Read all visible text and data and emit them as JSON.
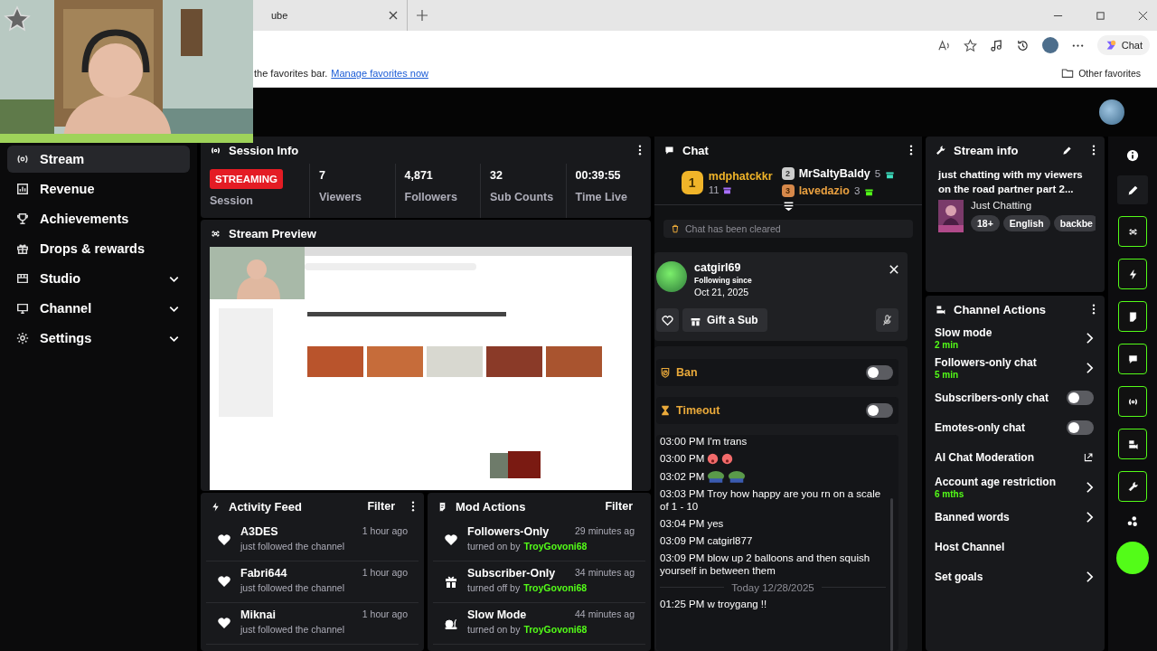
{
  "browser": {
    "tab_title": "ube",
    "favorites_hint": "the favorites bar.",
    "favorites_link": "Manage favorites now",
    "other_favorites": "Other favorites",
    "chat_button": "Chat"
  },
  "sidebar": {
    "items": [
      {
        "label": "Stream",
        "selected": true,
        "expandable": false
      },
      {
        "label": "Revenue",
        "selected": false,
        "expandable": false
      },
      {
        "label": "Achievements",
        "selected": false,
        "expandable": false
      },
      {
        "label": "Drops & rewards",
        "selected": false,
        "expandable": false
      },
      {
        "label": "Studio",
        "selected": false,
        "expandable": true
      },
      {
        "label": "Channel",
        "selected": false,
        "expandable": true
      },
      {
        "label": "Settings",
        "selected": false,
        "expandable": true
      }
    ]
  },
  "session": {
    "title": "Session Info",
    "status": "STREAMING",
    "caption": "Session",
    "stats": [
      {
        "value": "7",
        "label": "Viewers"
      },
      {
        "value": "4,871",
        "label": "Followers"
      },
      {
        "value": "32",
        "label": "Sub Counts"
      },
      {
        "value": "00:39:55",
        "label": "Time Live"
      }
    ]
  },
  "preview": {
    "title": "Stream Preview"
  },
  "activity_feed": {
    "title": "Activity Feed",
    "filter": "Filter",
    "items": [
      {
        "name": "A3DES",
        "time": "1 hour ago",
        "text": "just followed the channel"
      },
      {
        "name": "Fabri644",
        "time": "1 hour ago",
        "text": "just followed the channel"
      },
      {
        "name": "Miknai",
        "time": "1 hour ago",
        "text": "just followed the channel"
      }
    ]
  },
  "mod_actions": {
    "title": "Mod Actions",
    "filter": "Filter",
    "items": [
      {
        "kind": "heart",
        "title": "Followers-Only",
        "time": "29 minutes ag",
        "action": "turned on by",
        "user": "TroyGovoni68"
      },
      {
        "kind": "gift",
        "title": "Subscriber-Only",
        "time": "34 minutes ag",
        "action": "turned off by",
        "user": "TroyGovoni68"
      },
      {
        "kind": "snail",
        "title": "Slow Mode",
        "time": "44 minutes ag",
        "action": "turned on by",
        "user": "TroyGovoni68"
      }
    ]
  },
  "chat": {
    "title": "Chat",
    "leaders": [
      {
        "rank": "1",
        "name": "mdphatckkr",
        "count": "11",
        "color": "#a970ff"
      },
      {
        "rank": "2",
        "name": "MrSaltyBaldy",
        "count": "5",
        "color": "#3de0c0"
      },
      {
        "rank": "3",
        "name": "lavedazio",
        "count": "3",
        "color": "#53fc18"
      }
    ],
    "cleared": "Chat has been cleared",
    "user": {
      "name": "catgirl69",
      "following_label": "Following since",
      "date": "Oct 21, 2025",
      "gift": "Gift a Sub"
    },
    "moderation": [
      {
        "kind": "ban",
        "label": "Ban",
        "on": false
      },
      {
        "kind": "timeout",
        "label": "Timeout",
        "on": false
      }
    ],
    "messages": [
      {
        "kind": "text",
        "text": "03:00 PM I'm trans"
      },
      {
        "kind": "faces",
        "text": "03:00 PM"
      },
      {
        "kind": "frogs",
        "text": "03:02 PM"
      },
      {
        "kind": "text",
        "text": "03:03 PM Troy how happy are you rn on a scale of 1 - 10"
      },
      {
        "kind": "text",
        "text": "03:04 PM yes"
      },
      {
        "kind": "text",
        "text": "03:09 PM catgirl877"
      },
      {
        "kind": "text",
        "text": "03:09 PM blow up 2 balloons and then squish yourself in between them"
      },
      {
        "kind": "divider",
        "text": "Today 12/28/2025"
      },
      {
        "kind": "text",
        "text": "01:25 PM w troygang !!"
      }
    ]
  },
  "stream_info": {
    "title": "Stream info",
    "stream_title": "just chatting with my viewers on the road partner part 2...",
    "category": "Just Chatting",
    "tags": [
      "18+",
      "English",
      "backbe"
    ]
  },
  "channel_actions": {
    "title": "Channel Actions",
    "items": [
      {
        "kind": "link",
        "label": "Slow mode",
        "value": "2 min"
      },
      {
        "kind": "link",
        "label": "Followers-only chat",
        "value": "5 min"
      },
      {
        "kind": "toggle",
        "label": "Subscribers-only chat",
        "on": false
      },
      {
        "kind": "toggle",
        "label": "Emotes-only chat",
        "on": false
      },
      {
        "kind": "external",
        "label": "AI Chat Moderation"
      },
      {
        "kind": "link",
        "label": "Account age restriction",
        "value": "6 mths"
      },
      {
        "kind": "link",
        "label": "Banned words"
      },
      {
        "kind": "plain",
        "label": "Host Channel"
      },
      {
        "kind": "link",
        "label": "Set goals"
      }
    ]
  }
}
